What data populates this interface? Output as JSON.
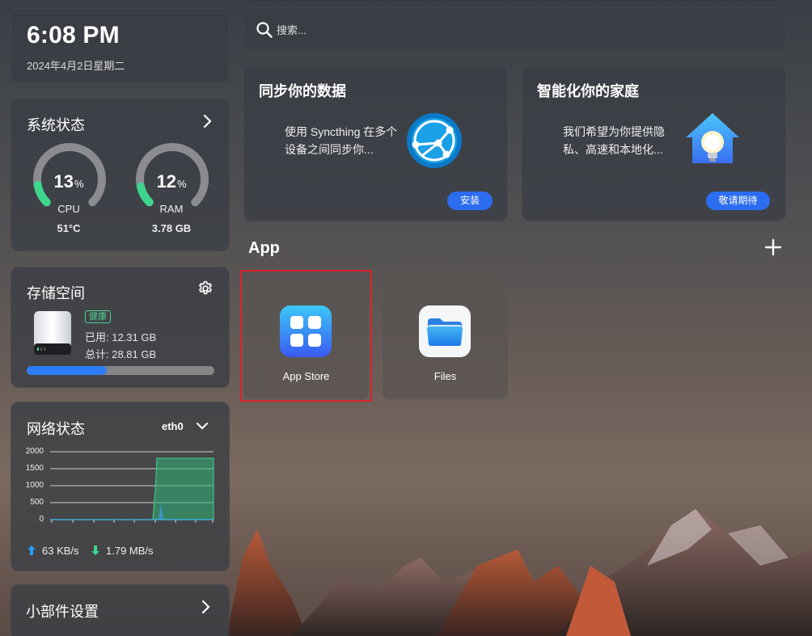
{
  "clock": {
    "time": "6:08 PM",
    "date": "2024年4月2日星期二"
  },
  "system": {
    "title": "系统状态",
    "cpu": {
      "value": "13",
      "unit": "%",
      "label": "CPU",
      "sub": "51°C",
      "percent": 13
    },
    "ram": {
      "value": "12",
      "unit": "%",
      "label": "RAM",
      "sub": "3.78 GB",
      "percent": 12
    }
  },
  "storage": {
    "title": "存储空间",
    "status": "健康",
    "used": "已用: 12.31 GB",
    "total": "总计: 28.81 GB",
    "used_fraction": 0.427
  },
  "network": {
    "title": "网络状态",
    "interface": "eth0",
    "y_ticks": [
      "2000",
      "1500",
      "1000",
      "500",
      "0"
    ],
    "upload": "63 KB/s",
    "download": "1.79 MB/s"
  },
  "widgets": {
    "title": "小部件设置"
  },
  "search": {
    "placeholder": "搜索..."
  },
  "promos": [
    {
      "title": "同步你的数据",
      "desc": "使用 Syncthing 在多个设备之间同步你...",
      "button": "安装"
    },
    {
      "title": "智能化你的家庭",
      "desc": "我们希望为你提供隐私、高速和本地化...",
      "button": "敬请期待"
    }
  ],
  "apps": {
    "section_title": "App",
    "items": [
      {
        "name": "App Store"
      },
      {
        "name": "Files"
      }
    ]
  },
  "colors": {
    "accent": "#2c6cf0",
    "gauge_fill": "#3ed68c",
    "healthy": "#4cd494",
    "highlight": "#d9242b"
  }
}
